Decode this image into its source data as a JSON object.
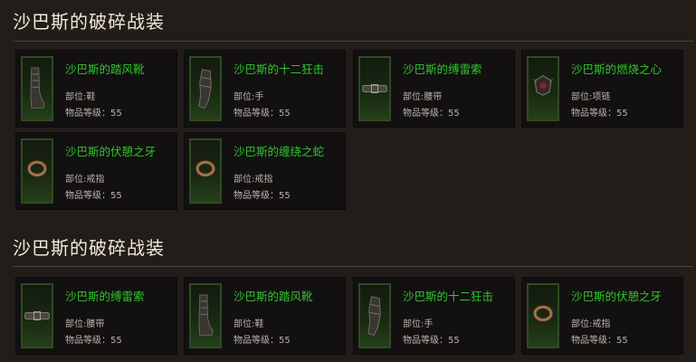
{
  "sets": [
    {
      "title": "沙巴斯的破碎战装",
      "items": [
        {
          "name": "沙巴斯的踏风靴",
          "slot": "部位:鞋",
          "level": "物品等级：55",
          "icon": "boots-icon"
        },
        {
          "name": "沙巴斯的十二狂击",
          "slot": "部位:手",
          "level": "物品等级：55",
          "icon": "gauntlet-icon"
        },
        {
          "name": "沙巴斯的缚雷索",
          "slot": "部位:腰带",
          "level": "物品等级：55",
          "icon": "belt-icon"
        },
        {
          "name": "沙巴斯的燃烧之心",
          "slot": "部位:项链",
          "level": "物品等级：55",
          "icon": "amulet-icon"
        },
        {
          "name": "沙巴斯的伏憩之牙",
          "slot": "部位:戒指",
          "level": "物品等级：55",
          "icon": "ring-icon"
        },
        {
          "name": "沙巴斯的缠绕之蛇",
          "slot": "部位:戒指",
          "level": "物品等级：55",
          "icon": "ring-icon"
        }
      ]
    },
    {
      "title": "沙巴斯的破碎战装",
      "items": [
        {
          "name": "沙巴斯的缚雷索",
          "slot": "部位:腰带",
          "level": "物品等级：55",
          "icon": "belt-icon"
        },
        {
          "name": "沙巴斯的踏风靴",
          "slot": "部位:鞋",
          "level": "物品等级：55",
          "icon": "boots-icon"
        },
        {
          "name": "沙巴斯的十二狂击",
          "slot": "部位:手",
          "level": "物品等级：55",
          "icon": "gauntlet-icon"
        },
        {
          "name": "沙巴斯的伏憩之牙",
          "slot": "部位:戒指",
          "level": "物品等级：55",
          "icon": "ring-icon"
        }
      ]
    }
  ],
  "colors": {
    "background": "#221d19",
    "card": "#121010",
    "item_name": "#2fc52c",
    "title": "#f0e7db",
    "icon_frame_border": "#2f4a22"
  }
}
